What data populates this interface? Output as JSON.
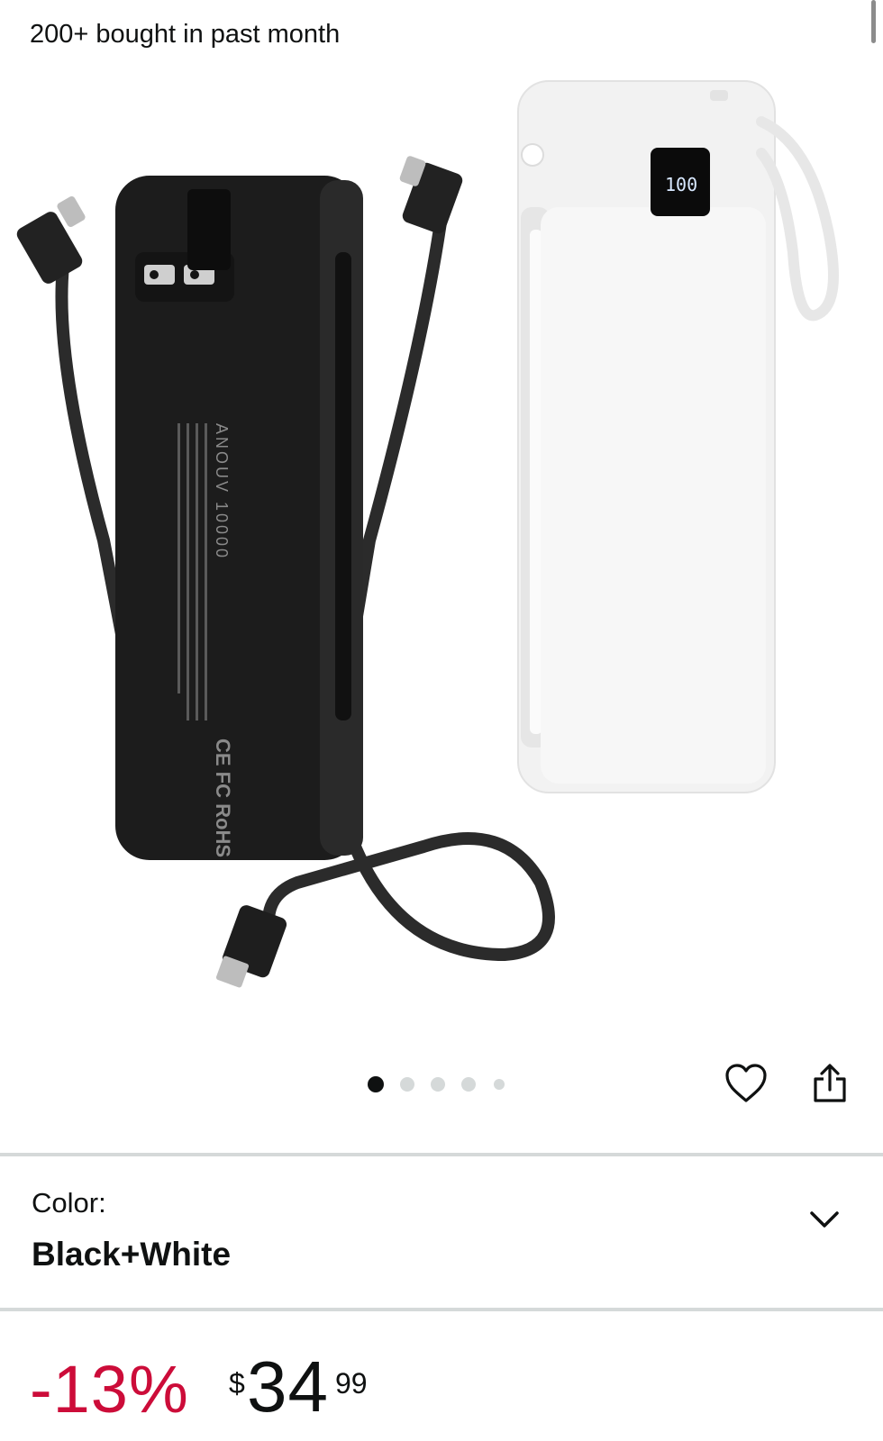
{
  "header": {
    "bought_text": "200+ bought in past month"
  },
  "gallery": {
    "image_label": "power-bank-product-image",
    "black_bank_brand": "ANOUV 10000",
    "black_bank_marks": "CE FC RoHS",
    "white_bank_display": "100",
    "active_index": 0,
    "dot_count": 5
  },
  "actions": {
    "favorite_icon": "heart-icon",
    "share_icon": "share-icon"
  },
  "color": {
    "label": "Color:",
    "value": "Black+White"
  },
  "price": {
    "discount": "-13%",
    "currency": "$",
    "whole": "34",
    "fraction": "99",
    "discount_color": "#cc0c39"
  }
}
